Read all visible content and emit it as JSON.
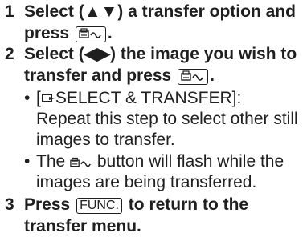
{
  "steps": [
    {
      "number": "1",
      "line1_pre": "Select (",
      "line1_arrows": "▲▼",
      "line1_post": ") a transfer option and",
      "line2_pre": "press",
      "line2_post": ".",
      "button_icon": "print-share-button-icon"
    },
    {
      "number": "2",
      "line1_pre": "Select (",
      "line1_arrows": "◀▶",
      "line1_post": ") the image you wish to",
      "line2_pre": "transfer and press",
      "line2_post": ".",
      "button_icon": "print-share-button-icon"
    },
    {
      "number": "3",
      "line1_pre": "Press",
      "key_label": "FUNC.",
      "line1_post": "to return to the",
      "line2": "transfer menu."
    }
  ],
  "bullets": [
    {
      "bullet": "•",
      "line1_pre": "[",
      "mode_icon": "select-transfer-icon",
      "line1_post": "SELECT & TRANSFER]:",
      "line2": "Repeat this step to select other still",
      "line3": "images to transfer."
    },
    {
      "bullet": "•",
      "line1_pre": "The",
      "button_icon": "print-share-button-icon",
      "line1_post": "button will flash while the",
      "line2": "images are being transferred."
    }
  ]
}
